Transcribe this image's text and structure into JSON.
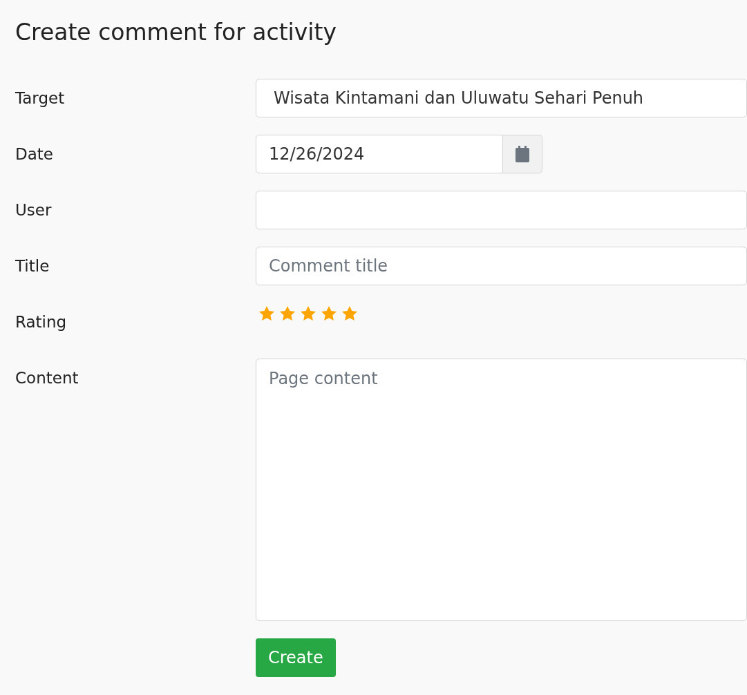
{
  "title": "Create comment for activity",
  "fields": [
    {
      "kind": "select",
      "label": "Target",
      "value": "Wisata Kintamani dan Uluwatu Sehari Penuh"
    },
    {
      "kind": "date",
      "label": "Date",
      "value": "12/26/2024"
    },
    {
      "kind": "text",
      "label": "User"
    },
    {
      "kind": "text",
      "label": "Title",
      "placeholder": "Comment title"
    },
    {
      "kind": "rating",
      "label": "Rating",
      "stars": 5
    },
    {
      "kind": "textarea",
      "label": "Content",
      "placeholder": "Page content"
    }
  ],
  "submit": "Create"
}
